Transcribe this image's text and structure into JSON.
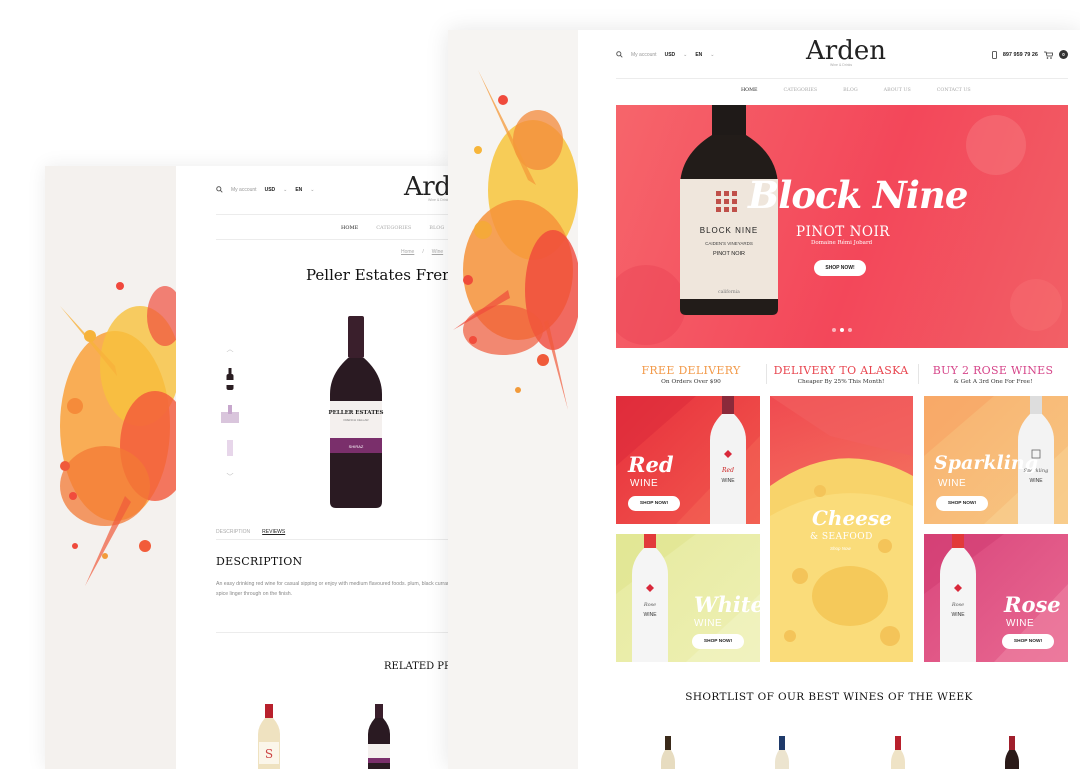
{
  "product_page": {
    "topbar": {
      "account": "My account",
      "currency": "USD",
      "language": "EN"
    },
    "logo": "Arden",
    "logo_sub": "Wine & Drinks",
    "nav": [
      "Home",
      "Categories",
      "Blog"
    ],
    "breadcrumb": [
      "Home",
      "/",
      "Wine"
    ],
    "product_title": "Peller Estates French Cabernet",
    "bottle_label": {
      "brand": "PELLER ESTATES",
      "sub": "FRENCH CELLAR",
      "variety": "SHIRAZ"
    },
    "tabs": [
      "Description",
      "Reviews"
    ],
    "description_title": "DESCRIPTION",
    "description_text": "An easy drinking red wine for casual sipping or enjoy with medium flavoured foods. plum, black currant and spice linger through on the finish.",
    "related_title": "RELATED PRODUCTS"
  },
  "home_page": {
    "topbar": {
      "account": "My account",
      "currency": "USD",
      "language": "EN"
    },
    "logo": "Arden",
    "logo_sub": "Wine & Drinks",
    "phone": "897 959 79 26",
    "cart_count": "0",
    "nav": [
      "Home",
      "Categories",
      "Blog",
      "About us",
      "Contact us"
    ],
    "hero": {
      "title": "Block Nine",
      "subtitle": "PINOT NOIR",
      "tagline": "Domaine Rémi Jobard",
      "button": "SHOP NOW!",
      "bottle_label": {
        "brand": "BLOCK NINE",
        "line1": "CAIDEN'S VINEYARDS",
        "line2": "PINOT NOIR",
        "line3": "california"
      },
      "slides": 3,
      "active_slide": 1
    },
    "promos": [
      {
        "title": "FREE DELIVERY",
        "subtitle": "On Orders Over $90",
        "color": "#f29a4a"
      },
      {
        "title": "DELIVERY TO ALASKA",
        "subtitle": "Cheaper By 25% This Month!",
        "color": "#e8454f"
      },
      {
        "title": "BUY 2 ROSE WINES",
        "subtitle": "& Get A 3rd One For Free!",
        "color": "#d6468a"
      }
    ],
    "tiles": {
      "red": {
        "name": "Red",
        "wine": "WINE",
        "button": "SHOP NOW!"
      },
      "cheese": {
        "name": "Cheese",
        "sub": "& SEAFOOD",
        "link": "Shop Now"
      },
      "sparkling": {
        "name": "Sparkling",
        "wine": "WINE",
        "button": "SHOP NOW!"
      },
      "white": {
        "name": "White",
        "wine": "WINE",
        "button": "SHOP NOW!"
      },
      "rose": {
        "name": "Rose",
        "wine": "WINE",
        "button": "SHOP NOW!"
      }
    },
    "bottle_labels": {
      "red": [
        "Red",
        "WINE"
      ],
      "sparkling": [
        "Sparkling",
        "WINE"
      ],
      "white": [
        "Rose",
        "WINE"
      ],
      "rose": [
        "Rose",
        "WINE"
      ]
    },
    "shortlist_title": "SHORTLIST OF OUR BEST WINES OF THE WEEK"
  }
}
